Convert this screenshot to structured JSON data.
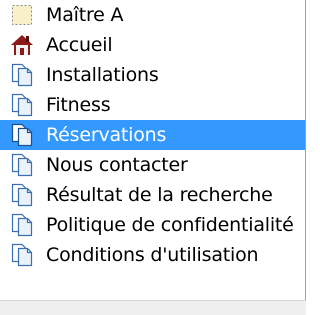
{
  "pages": {
    "items": [
      {
        "label": "Maître A",
        "icon": "master-page-icon",
        "selected": false
      },
      {
        "label": "Accueil",
        "icon": "home-icon",
        "selected": false
      },
      {
        "label": "Installations",
        "icon": "page-icon",
        "selected": false
      },
      {
        "label": "Fitness",
        "icon": "page-icon",
        "selected": false
      },
      {
        "label": "Réservations",
        "icon": "page-icon",
        "selected": true
      },
      {
        "label": "Nous contacter",
        "icon": "page-icon",
        "selected": false
      },
      {
        "label": "Résultat de la recherche",
        "icon": "page-icon",
        "selected": false
      },
      {
        "label": "Politique de confidentialité",
        "icon": "page-icon",
        "selected": false
      },
      {
        "label": "Conditions d'utilisation",
        "icon": "page-icon",
        "selected": false
      }
    ]
  },
  "colors": {
    "selection": "#3399ff",
    "selection_text": "#ffffff",
    "text": "#000000",
    "home_roof": "#8b1a1a",
    "page_icon_blue": "#3a6fb0"
  }
}
